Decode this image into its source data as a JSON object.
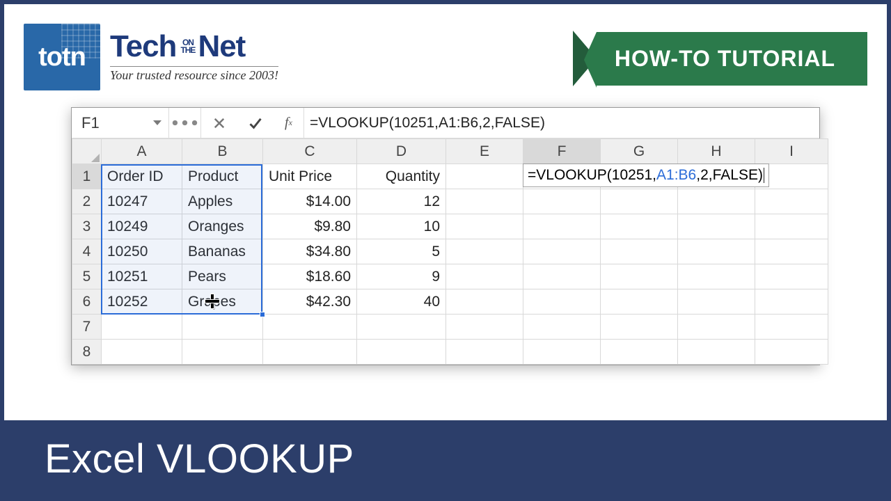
{
  "brand": {
    "badge": "totn",
    "name_a": "Tech",
    "name_mid_top": "ON",
    "name_mid_bot": "THE",
    "name_b": "Net",
    "tagline": "Your trusted resource since 2003!"
  },
  "howto_label": "HOW-TO TUTORIAL",
  "footer_title": "Excel VLOOKUP",
  "excel": {
    "name_box": "F1",
    "formula": "=VLOOKUP(10251,A1:B6,2,FALSE)",
    "editing_prefix": "=VLOOKUP(10251,",
    "editing_range": "A1:B6",
    "editing_suffix": ",2,FALSE)",
    "columns": [
      "A",
      "B",
      "C",
      "D",
      "E",
      "F",
      "G",
      "H",
      "I"
    ],
    "row_numbers": [
      "1",
      "2",
      "3",
      "4",
      "5",
      "6",
      "7",
      "8"
    ],
    "headers": {
      "A": "Order ID",
      "B": "Product",
      "C": "Unit Price",
      "D": "Quantity"
    },
    "rows": [
      {
        "A": "10247",
        "B": "Apples",
        "C": "$14.00",
        "D": "12"
      },
      {
        "A": "10249",
        "B": "Oranges",
        "C": "$9.80",
        "D": "10"
      },
      {
        "A": "10250",
        "B": "Bananas",
        "C": "$34.80",
        "D": "5"
      },
      {
        "A": "10251",
        "B": "Pears",
        "C": "$18.60",
        "D": "9"
      },
      {
        "A": "10252",
        "B": "Grapes",
        "C": "$42.30",
        "D": "40"
      }
    ]
  }
}
